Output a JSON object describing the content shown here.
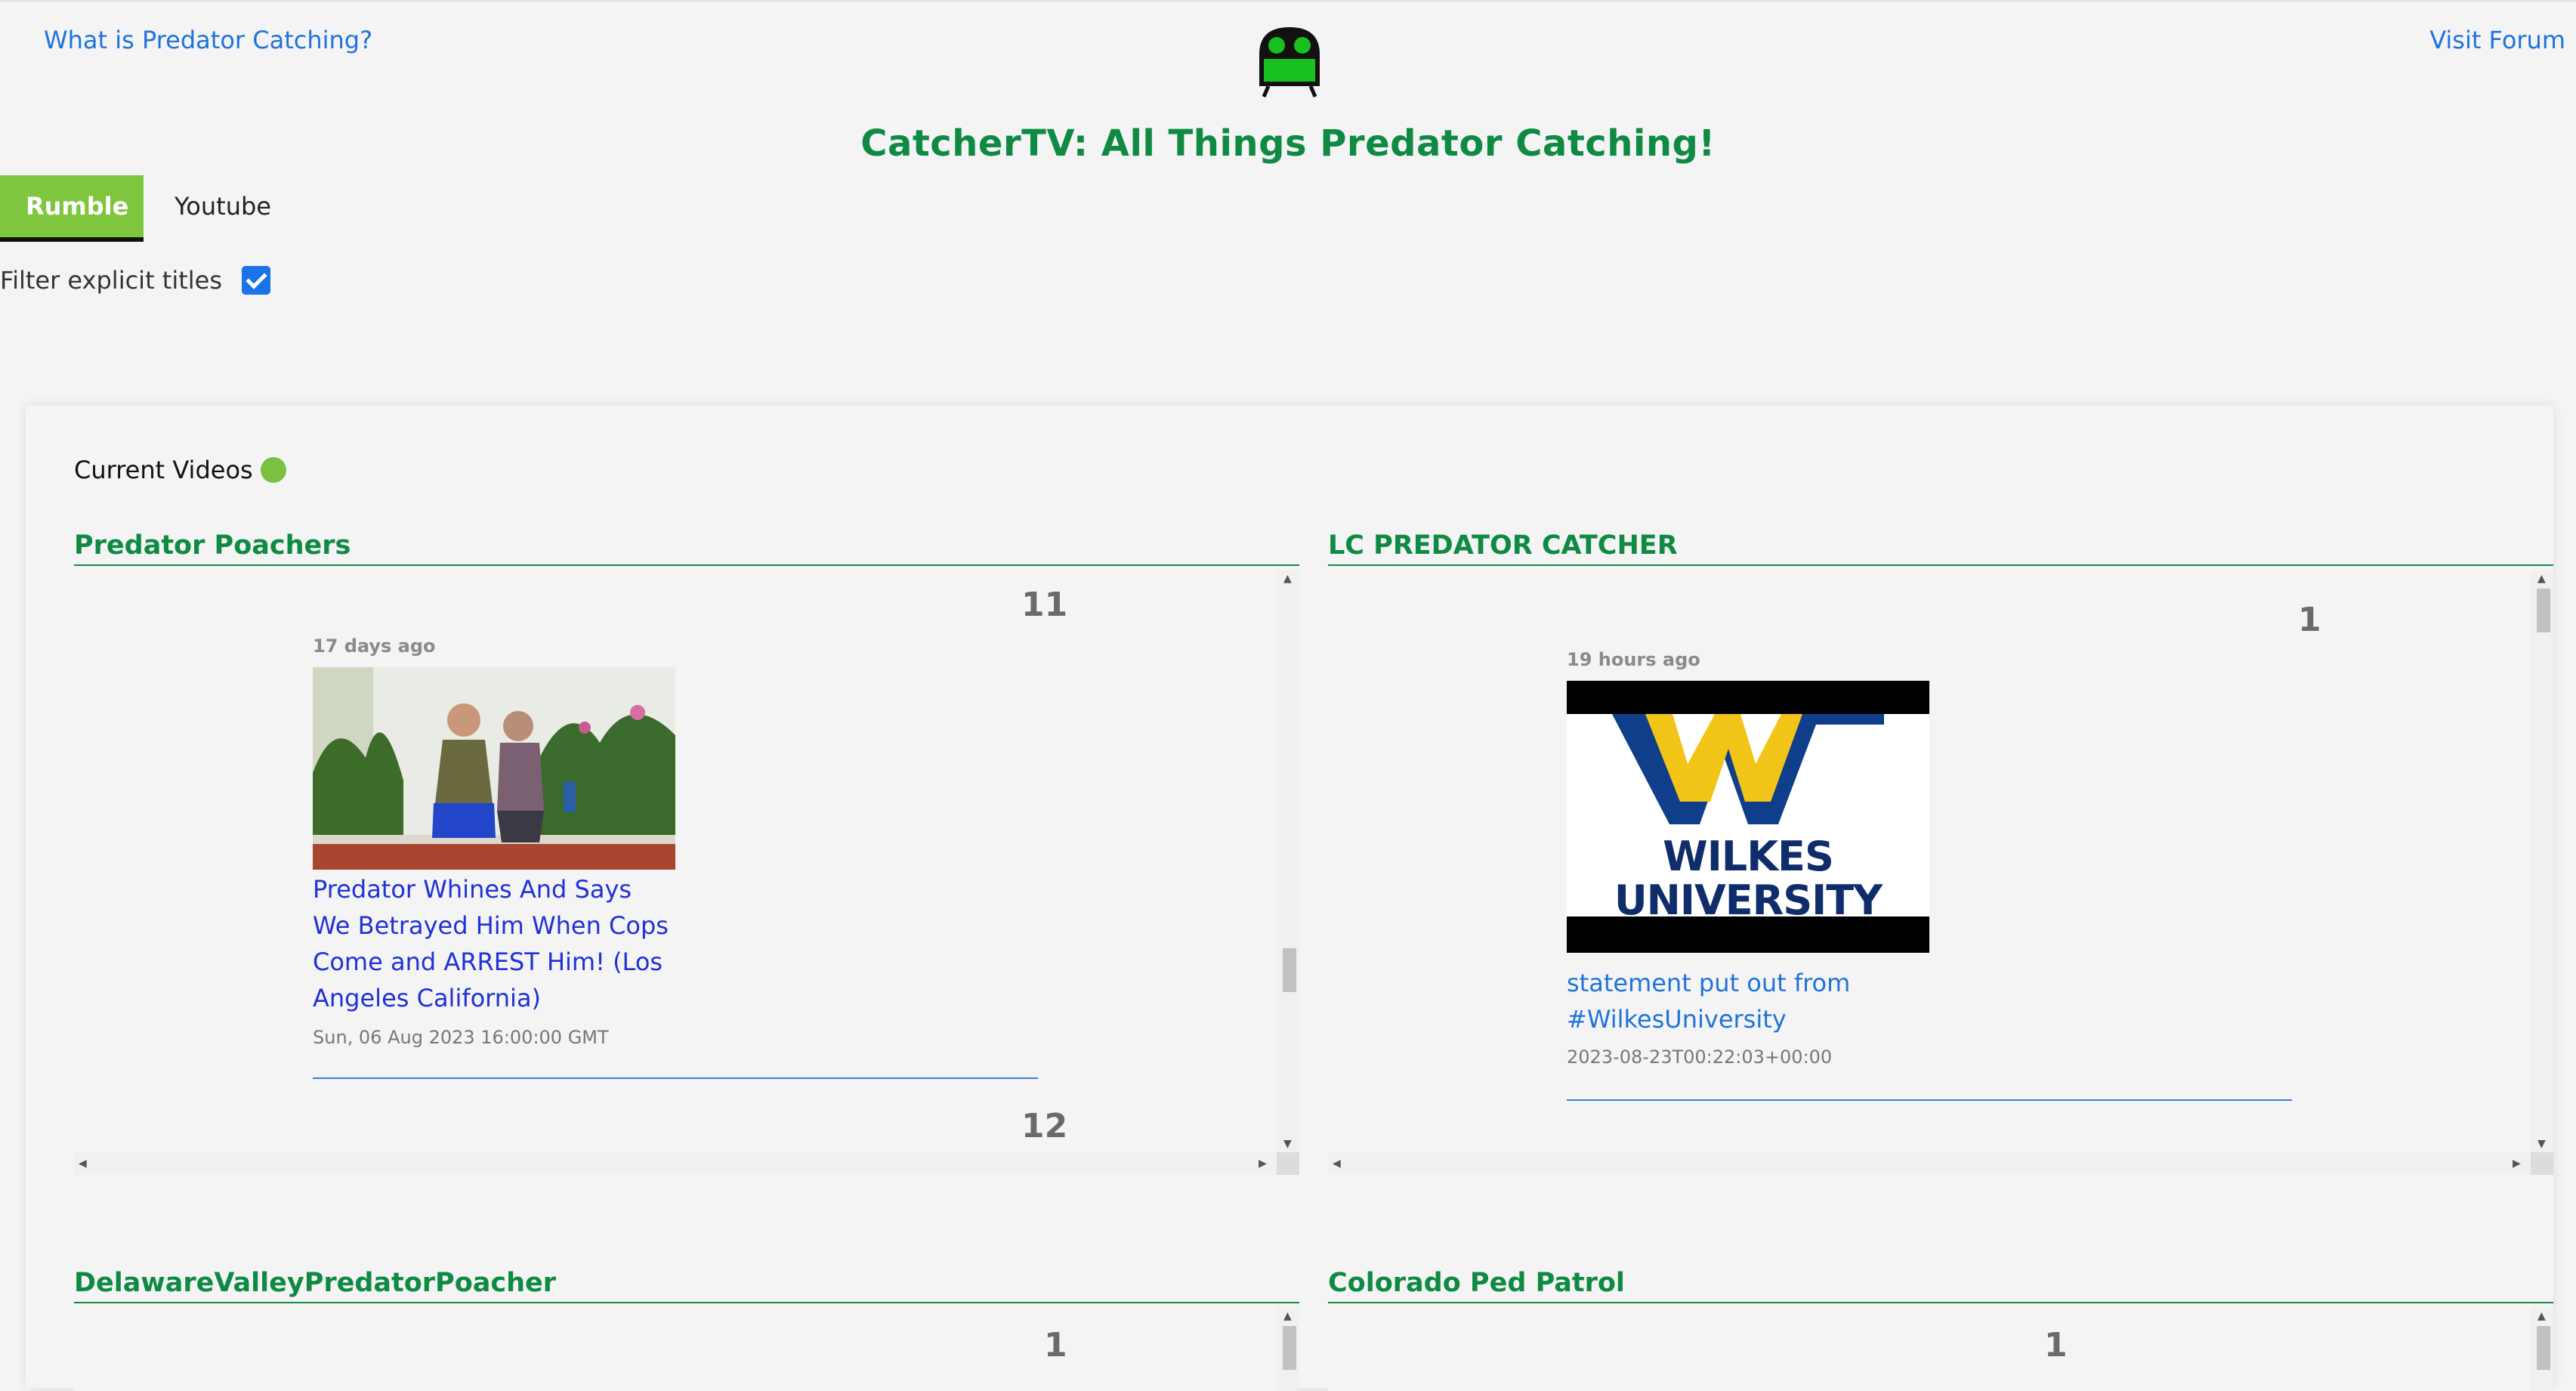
{
  "header": {
    "about_link": "What is Predator Catching?",
    "forum_link": "Visit Forum",
    "title": "CatcherTV: All Things Predator Catching!"
  },
  "tabs": [
    {
      "label": "Rumble",
      "active": true
    },
    {
      "label": "Youtube",
      "active": false
    }
  ],
  "filter": {
    "label": "Filter explicit titles",
    "checked": true
  },
  "current_videos": {
    "label": "Current Videos",
    "status_color": "#7ac142"
  },
  "channels": [
    {
      "name": "Predator Poachers",
      "videos": [
        {
          "rank": "11",
          "ago": "17 days ago",
          "title": "Predator Whines And Says We Betrayed Him When Cops Come and ARREST Him! (Los Angeles California)",
          "date": "Sun, 06 Aug 2023 16:00:00 GMT"
        },
        {
          "rank": "12"
        }
      ]
    },
    {
      "name": "LC PREDATOR CATCHER",
      "videos": [
        {
          "rank": "1",
          "ago": "19 hours ago",
          "thumb_text": "WILKES\nUNIVERSITY",
          "title": "statement put out from #WilkesUniversity",
          "date": "2023-08-23T00:22:03+00:00"
        }
      ]
    },
    {
      "name": "DelawareValleyPredatorPoacher",
      "videos": [
        {
          "rank": "1"
        }
      ]
    },
    {
      "name": "Colorado Ped Patrol",
      "videos": [
        {
          "rank": "1"
        }
      ]
    }
  ],
  "colors": {
    "brand_green": "#0e8a42",
    "tab_active": "#7ec63d",
    "link_blue": "#1f73da",
    "video_link": "#2031d6"
  }
}
